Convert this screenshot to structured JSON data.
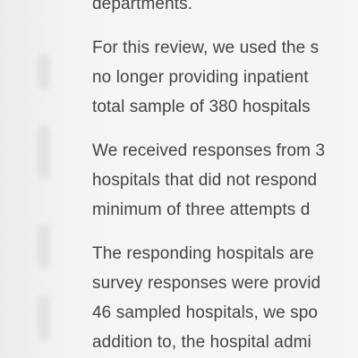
{
  "document": {
    "paragraphs": [
      {
        "lines": [
          "departments."
        ]
      },
      {
        "lines": [
          "For this review, we used the s",
          "no longer providing inpatient",
          "total sample of 380 hospitals"
        ]
      },
      {
        "lines": [
          "We received responses from 3",
          "hospitals that did not respond",
          "minimum of three attempts d"
        ]
      },
      {
        "lines": [
          "The responding hospitals are",
          "survey responses were provid",
          "46 sampled hospitals, we spo",
          "addition to, the hospital admi"
        ]
      }
    ]
  }
}
